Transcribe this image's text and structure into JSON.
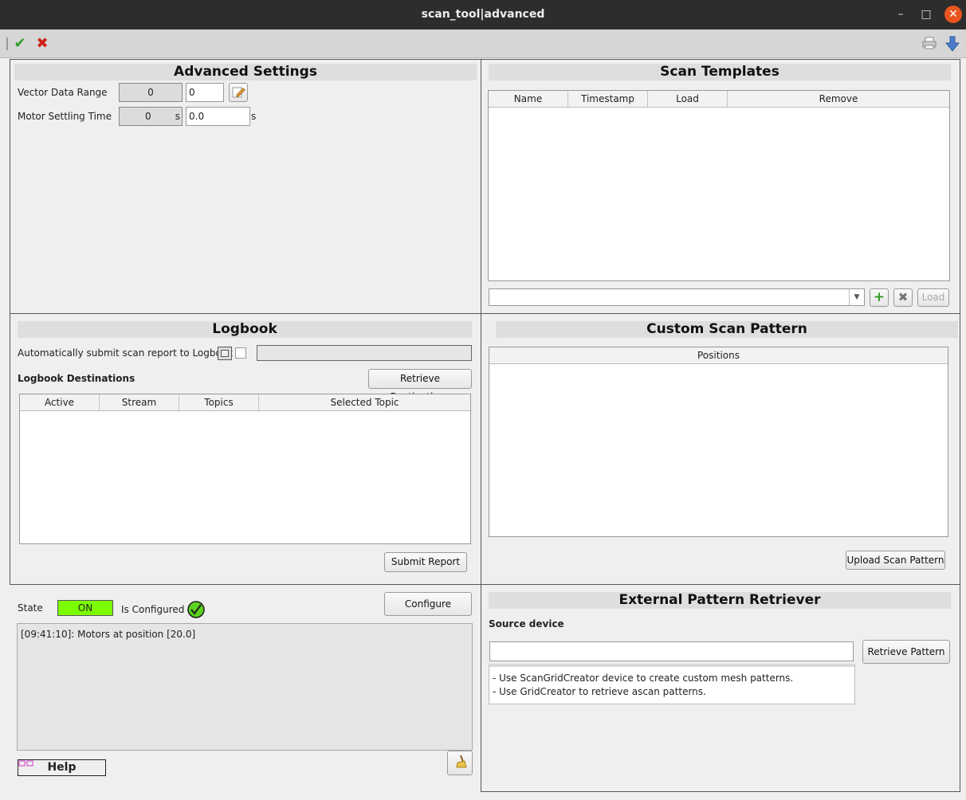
{
  "window": {
    "title": "scan_tool|advanced",
    "minimize": "–",
    "maximize": "□",
    "close": "✕"
  },
  "toolbar": {
    "apply_icon": "✔",
    "cancel_icon": "✖"
  },
  "advanced_settings": {
    "title": "Advanced Settings",
    "vector_label": "Vector Data Range",
    "vector_value": "0",
    "vector_input": "0",
    "motor_label": "Motor Settling Time",
    "motor_value": "0",
    "motor_unit": "s",
    "motor_input": "0.0",
    "motor_input_unit": "s"
  },
  "scan_templates": {
    "title": "Scan Templates",
    "columns": [
      "Name",
      "Timestamp",
      "Load",
      "Remove"
    ],
    "combo_value": "",
    "load_label": "Load"
  },
  "logbook": {
    "title": "Logbook",
    "auto_submit_label": "Automatically submit scan report to Logbook",
    "destinations_label": "Logbook Destinations",
    "retrieve_label": "Retrieve Destinations",
    "columns": [
      "Active",
      "Stream",
      "Topics",
      "Selected Topic"
    ],
    "submit_label": "Submit Report"
  },
  "custom_pattern": {
    "title": "Custom Scan Pattern",
    "columns": [
      "Positions"
    ],
    "upload_label": "Upload Scan Pattern"
  },
  "status": {
    "state_label": "State",
    "state_value": "ON",
    "state_color": "#7cfc00",
    "configured_label": "Is Configured",
    "configure_label": "Configure",
    "log_line": "[09:41:10]: Motors at position [20.0]",
    "help_label": "Help"
  },
  "external": {
    "title": "External Pattern Retriever",
    "source_label": "Source device",
    "source_value": "",
    "retrieve_label": "Retrieve Pattern",
    "hint_line1": "- Use ScanGridCreator device to create custom mesh patterns.",
    "hint_line2": "- Use GridCreator to retrieve ascan patterns."
  }
}
